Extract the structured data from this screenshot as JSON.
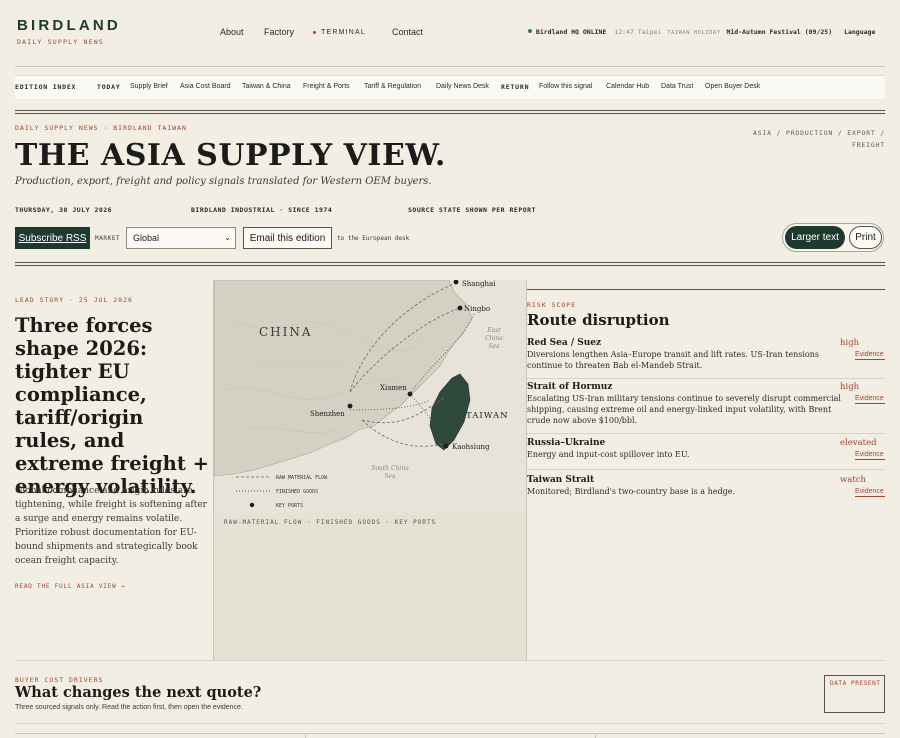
{
  "brand": {
    "title": "BIRDLAND",
    "subtitle": "DAILY SUPPLY NEWS"
  },
  "topnav": {
    "about": "About",
    "factory": "Factory",
    "terminal": "TERMINAL",
    "contact": "Contact"
  },
  "status": {
    "hq": "Birdland HQ ONLINE",
    "time": "12:47 Taipei",
    "holiday_tag": "TAIWAN HOLIDAY",
    "holiday": "Mid-Autumn Festival (09/25)",
    "language": "Language"
  },
  "edition_bar": {
    "label": "EDITION INDEX",
    "today": "TODAY",
    "today_items": [
      "Supply Brief",
      "Asia Cost Board",
      "Taiwan & China",
      "Freight & Ports",
      "Tariff & Regulation",
      "Daily News Desk"
    ],
    "return": "RETURN",
    "return_items": [
      "Follow this signal",
      "Calendar Hub",
      "Data Trust",
      "Open Buyer Desk"
    ]
  },
  "masthead": {
    "kicker": "DAILY SUPPLY NEWS · BIRDLAND TAIWAN",
    "headline": "THE ASIA SUPPLY VIEW.",
    "subhead": "Production, export, freight and policy signals translated for Western OEM buyers.",
    "right_line1": "ASIA / PRODUCTION / EXPORT /",
    "right_line2": "FREIGHT",
    "date": "THURSDAY, 30 JULY 2026",
    "company": "BIRDLAND INDUSTRIAL · SINCE 1974",
    "source": "SOURCE STATE SHOWN PER REPORT"
  },
  "toolbar": {
    "rss": "Subscribe RSS",
    "market_label": "MARKET",
    "market_value": "Global",
    "email": "Email this edition",
    "email_note": "to the European desk",
    "larger": "Larger text",
    "print": "Print"
  },
  "lead": {
    "kicker": "LEAD STORY · 25 JUL 2026",
    "headline": "Three forces shape 2026: tighter EU compliance, tariff/origin rules, and extreme freight + energy volatility.",
    "body": "Global compliance and origin rules are tightening, while freight is softening after a surge and energy remains volatile. Prioritize robust documentation for EU-bound shipments and strategically book ocean freight capacity.",
    "link": "READ THE FULL ASIA VIEW →"
  },
  "map": {
    "china": "CHINA",
    "taiwan": "TAIWAN",
    "east_china_sea": [
      "East",
      "China",
      "Sea"
    ],
    "south_china_sea": [
      "South China",
      "Sea"
    ],
    "shanghai": "Shanghai",
    "ningbo": "Ningbo",
    "xiamen": "Xiamen",
    "shenzhen": "Shenzhen",
    "kaohsiung": "Kaohsiung",
    "legend_raw": "RAW MATERIAL FLOW",
    "legend_finished": "FINISHED GOODS",
    "legend_ports": "KEY PORTS",
    "caption": "RAW-MATERIAL FLOW · FINISHED GOODS · KEY PORTS"
  },
  "risk": {
    "kicker": "RISK SCOPE",
    "title": "Route disruption",
    "rows": [
      {
        "name": "Red Sea / Suez",
        "desc": "Diversions lengthen Asia–Europe transit and lift rates. US-Iran tensions continue to threaten Bab el-Mandeb Strait.",
        "level": "high",
        "evidence": "Evidence"
      },
      {
        "name": "Strait of Hormuz",
        "desc": "Escalating US-Iran military tensions continue to severely disrupt commercial shipping, causing extreme oil and energy-linked input volatility, with Brent crude now above $100/bbl.",
        "level": "high",
        "evidence": "Evidence"
      },
      {
        "name": "Russia–Ukraine",
        "desc": "Energy and input-cost spillover into EU.",
        "level": "elevated",
        "evidence": "Evidence"
      },
      {
        "name": "Taiwan Strait",
        "desc": "Monitored; Birdland's two-country base is a hedge.",
        "level": "watch",
        "evidence": "Evidence"
      }
    ]
  },
  "drivers": {
    "kicker": "BUYER COST DRIVERS",
    "title": "What changes the next quote?",
    "sub": "Three sourced signals only. Read the action first, then open the evidence.",
    "badge": "DATA PRESENT"
  }
}
